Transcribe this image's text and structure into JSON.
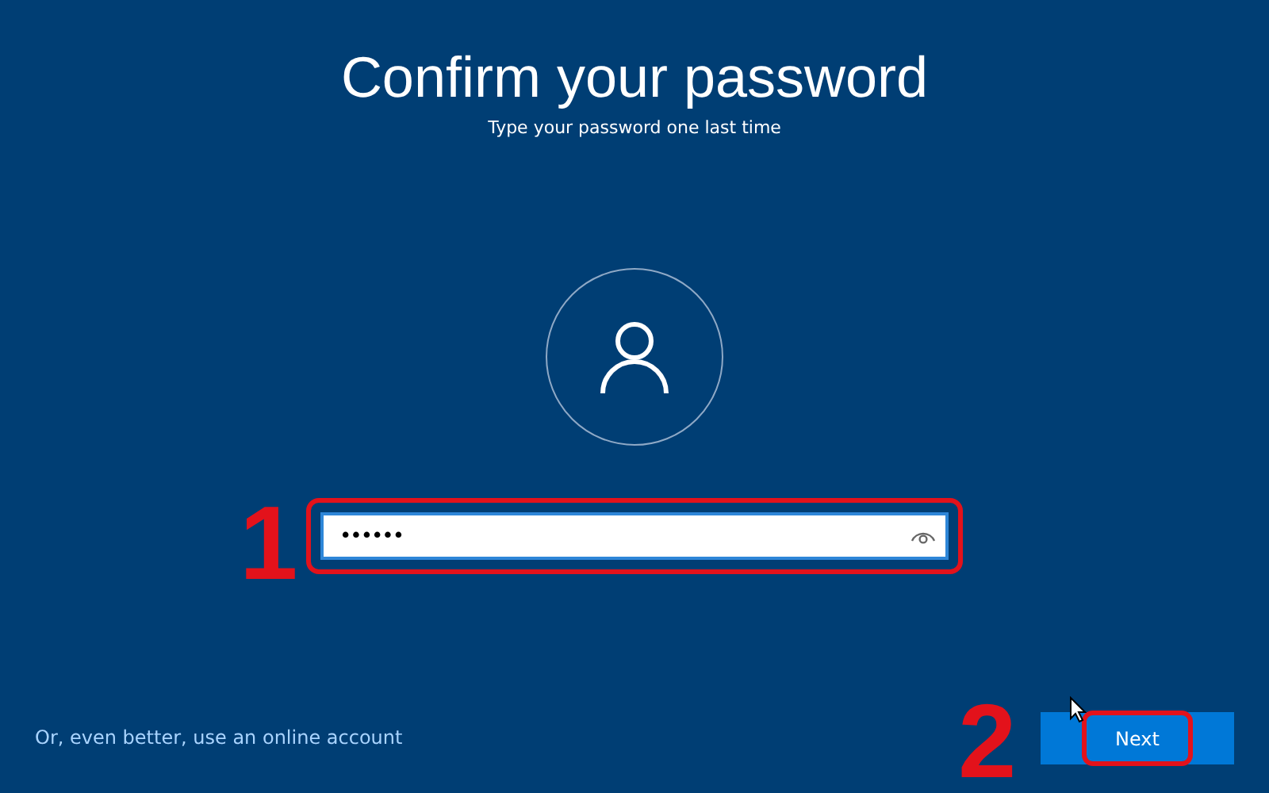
{
  "title": "Confirm your password",
  "subtitle": "Type your password one last time",
  "password_field": {
    "value": "••••••"
  },
  "link": "Or, even better, use an online account",
  "next_button": "Next",
  "annotations": [
    {
      "label": "1"
    },
    {
      "label": "2"
    }
  ]
}
